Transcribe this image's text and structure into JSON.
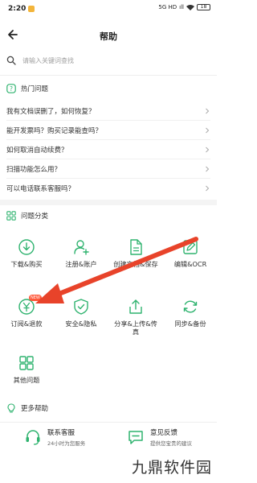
{
  "status_bar": {
    "time": "2:20",
    "network": "5G HD",
    "signal": "ıll",
    "battery": "18"
  },
  "header": {
    "title": "帮助"
  },
  "search": {
    "placeholder": "请输入关键词查找"
  },
  "hot": {
    "title": "热门问题",
    "items": [
      "我有文档误删了，如何恢复？",
      "能开发票吗？购买记录能查吗？",
      "如何取消自动续费？",
      "扫描功能怎么用？",
      "可以电话联系客服吗？"
    ]
  },
  "categories": {
    "title": "问题分类",
    "items": [
      "下载&购买",
      "注册&账户",
      "创建文档&保存",
      "编辑&OCR",
      "订阅&退款",
      "安全&隐私",
      "分享&上传&传真",
      "同步&备份",
      "其他问题"
    ],
    "new_badge": "NEW"
  },
  "more": {
    "title": "更多帮助"
  },
  "bottom": {
    "contact_title": "联系客服",
    "contact_sub": "24小时为您服务",
    "feedback_title": "意见反馈",
    "feedback_sub": "提供您宝贵的建议"
  },
  "watermark": "九鼎软件园",
  "colors": {
    "accent": "#2fb36f",
    "arrow": "#e8432a"
  }
}
